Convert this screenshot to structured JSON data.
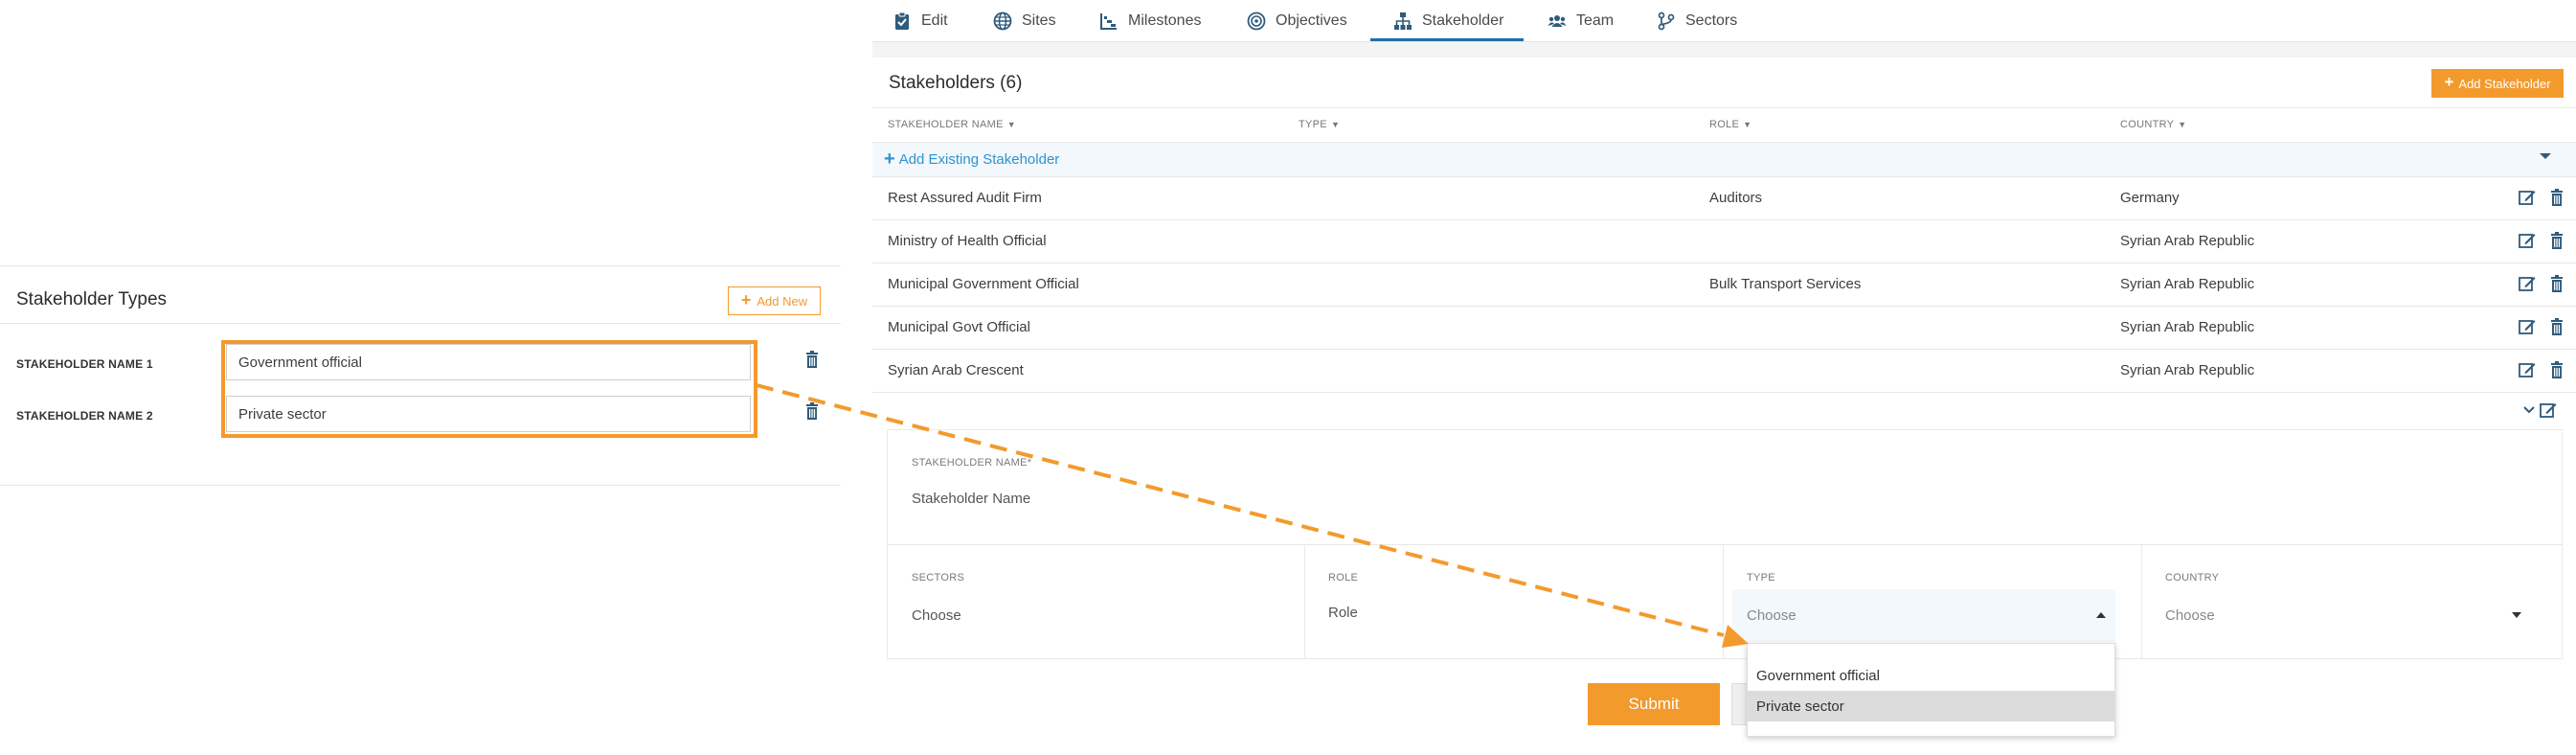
{
  "left_panel": {
    "title": "Stakeholder Types",
    "add_new_label": "Add New",
    "rows": [
      {
        "label": "STAKEHOLDER NAME 1",
        "value": "Government official"
      },
      {
        "label": "STAKEHOLDER NAME 2",
        "value": "Private sector"
      }
    ]
  },
  "tabs": [
    {
      "label": "Edit",
      "icon": "clipboard-icon"
    },
    {
      "label": "Sites",
      "icon": "globe-icon"
    },
    {
      "label": "Milestones",
      "icon": "chart-icon"
    },
    {
      "label": "Objectives",
      "icon": "target-icon"
    },
    {
      "label": "Stakeholder",
      "icon": "org-chart-icon",
      "active": true
    },
    {
      "label": "Team",
      "icon": "users-icon"
    },
    {
      "label": "Sectors",
      "icon": "branch-icon"
    }
  ],
  "stakeholders": {
    "title": "Stakeholders (6)",
    "add_button": "Add Stakeholder",
    "columns": [
      "STAKEHOLDER NAME",
      "TYPE",
      "ROLE",
      "COUNTRY"
    ],
    "add_existing": "Add Existing Stakeholder",
    "rows": [
      {
        "name": "Rest Assured Audit Firm",
        "type": "",
        "role": "Auditors",
        "country": "Germany"
      },
      {
        "name": "Ministry of Health Official",
        "type": "",
        "role": "",
        "country": "Syrian Arab Republic"
      },
      {
        "name": "Municipal Government Official",
        "type": "",
        "role": "Bulk Transport Services",
        "country": "Syrian Arab Republic"
      },
      {
        "name": "Municipal Govt Official",
        "type": "",
        "role": "",
        "country": "Syrian Arab Republic"
      },
      {
        "name": "Syrian Arab Crescent",
        "type": "",
        "role": "",
        "country": "Syrian Arab Republic"
      }
    ]
  },
  "form": {
    "name_label": "STAKEHOLDER NAME*",
    "name_placeholder": "Stakeholder Name",
    "sectors_label": "SECTORS",
    "sectors_value": "Choose",
    "role_label": "ROLE",
    "role_placeholder": "Role",
    "type_label": "TYPE",
    "type_value": "Choose",
    "country_label": "COUNTRY",
    "country_value": "Choose",
    "type_options": [
      "Government official",
      "Private sector"
    ],
    "selected_option": "Private sector",
    "submit_label": "Submit"
  },
  "colors": {
    "accent": "#f39a2c",
    "link": "#2f92cf",
    "active_tab": "#1e6fa8",
    "icon": "#2f5b7c"
  }
}
